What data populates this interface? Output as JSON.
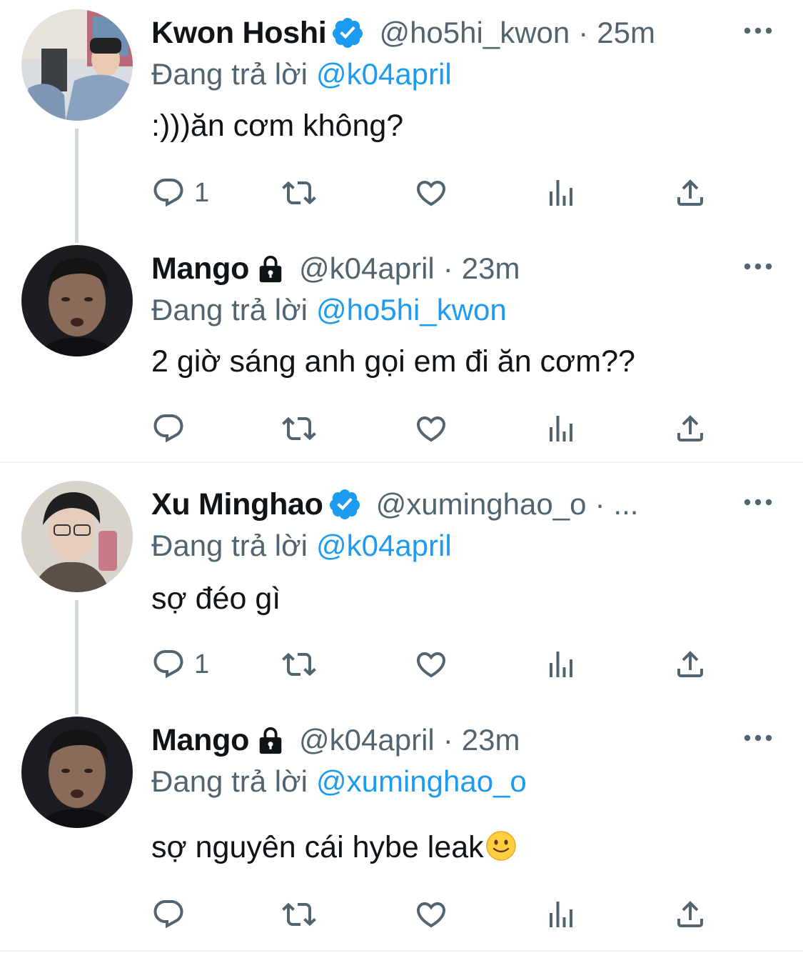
{
  "tweets": [
    {
      "name": "Kwon Hoshi",
      "verified": true,
      "locked": false,
      "handle": "@ho5hi_kwon",
      "separator": "·",
      "time": "25m",
      "replying_prefix": "Đang trả lời",
      "replying_to": "@k04april",
      "text": ":)))ăn cơm không?",
      "reply_count": "1"
    },
    {
      "name": "Mango",
      "verified": false,
      "locked": true,
      "handle": "@k04april",
      "separator": "·",
      "time": "23m",
      "replying_prefix": "Đang trả lời",
      "replying_to": "@ho5hi_kwon",
      "text": "2 giờ sáng anh gọi em đi ăn cơm??",
      "reply_count": ""
    },
    {
      "name": "Xu Minghao",
      "verified": true,
      "locked": false,
      "handle": "@xuminghao_o",
      "separator": "·",
      "time": "...",
      "replying_prefix": "Đang trả lời",
      "replying_to": "@k04april",
      "text": "sợ đéo gì",
      "reply_count": "1"
    },
    {
      "name": "Mango",
      "verified": false,
      "locked": true,
      "handle": "@k04april",
      "separator": "·",
      "time": "23m",
      "replying_prefix": "Đang trả lời",
      "replying_to": "@xuminghao_o",
      "text": "sợ nguyên cái hybe leak",
      "text_emoji": "slightly-smiling-face",
      "reply_count": ""
    }
  ],
  "icons": {
    "reply": "reply-icon",
    "retweet": "retweet-icon",
    "like": "heart-icon",
    "views": "analytics-icon",
    "share": "share-icon",
    "more": "more-icon",
    "verified": "verified-badge-icon",
    "lock": "lock-icon"
  },
  "colors": {
    "text": "#0f1419",
    "secondary": "#536471",
    "accent": "#1d9bf0",
    "thread_line": "#cfd9de",
    "divider": "#eff3f4"
  }
}
